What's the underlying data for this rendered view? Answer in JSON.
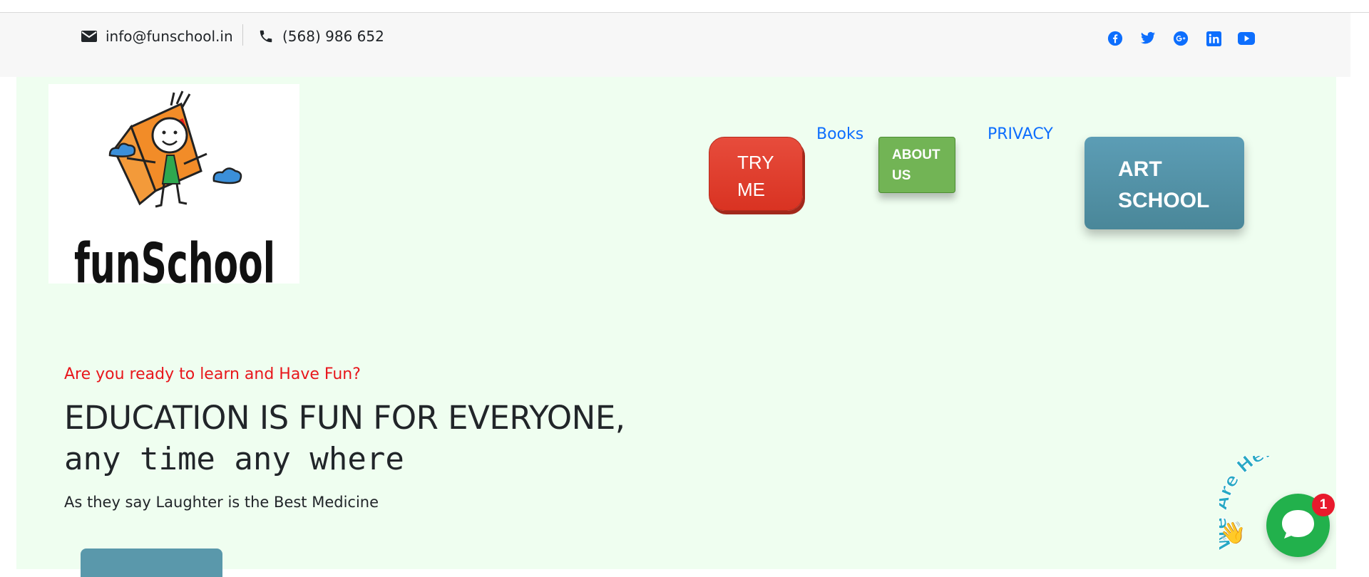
{
  "topbar": {
    "email": "info@funschool.in",
    "phone": "(568) 986 652",
    "socials": [
      "facebook-icon",
      "twitter-icon",
      "google-plus-icon",
      "linkedin-icon",
      "youtube-icon"
    ]
  },
  "header": {
    "logo_text": "funSchool",
    "nav": {
      "try_me": "TRY ME",
      "books": "Books",
      "about_us": "ABOUT US",
      "privacy": "PRIVACY",
      "art_school": "ART SCHOOL"
    }
  },
  "hero": {
    "pretitle": "Are you ready to learn and Have Fun?",
    "title": "EDUCATION IS FUN FOR EVERYONE,",
    "subtitle": "any time any where",
    "description": "As they say Laughter is the Best Medicine"
  },
  "chat": {
    "label": "We Are Here!",
    "count": "1"
  },
  "colors": {
    "accent_link": "#0d6efd",
    "pretitle_red": "#e8161b",
    "page_bg": "#effef0"
  }
}
